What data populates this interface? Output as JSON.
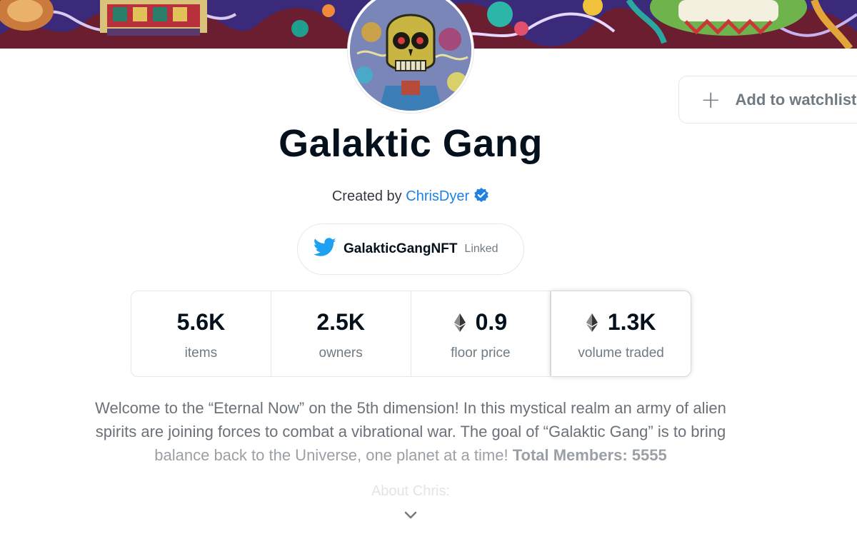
{
  "collection": {
    "name": "Galaktic Gang",
    "created_by_prefix": "Created by",
    "creator": "ChrisDyer"
  },
  "watchlist": {
    "label": "Add to watchlist"
  },
  "twitter": {
    "handle": "GalakticGangNFT",
    "status": "Linked"
  },
  "stats": [
    {
      "value": "5.6K",
      "label": "items",
      "eth": false
    },
    {
      "value": "2.5K",
      "label": "owners",
      "eth": false
    },
    {
      "value": "0.9",
      "label": "floor price",
      "eth": true
    },
    {
      "value": "1.3K",
      "label": "volume traded",
      "eth": true
    }
  ],
  "description": {
    "line1": "Welcome to the “Eternal Now” on the 5th dimension! In this mystical realm an army of alien",
    "line2": "spirits are joining forces to combat a vibrational war. The goal of “Galaktic Gang” is to bring",
    "line3": "balance back to the Universe, one planet at a time!",
    "line3_bold": "Total Members: 5555",
    "about": "About Chris:"
  },
  "colors": {
    "accent": "#2081e2",
    "text": "#04111d",
    "muted": "#707a83",
    "twitter": "#1da1f2"
  },
  "icons": [
    "plus-icon",
    "verified-badge-icon",
    "twitter-icon",
    "ethereum-icon",
    "chevron-down-icon"
  ]
}
